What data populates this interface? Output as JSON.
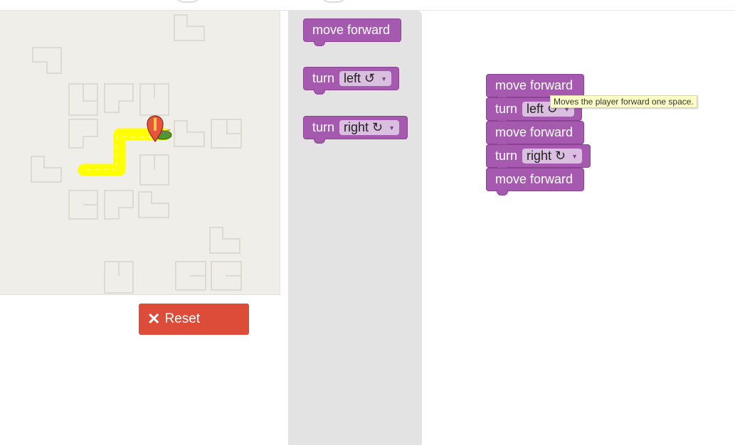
{
  "reset": {
    "label": "Reset",
    "icon": "close-icon"
  },
  "toolbox": {
    "blocks": [
      {
        "prefix": "move forward"
      },
      {
        "prefix": "turn",
        "option": "left ↺"
      },
      {
        "prefix": "turn",
        "option": "right ↻"
      }
    ]
  },
  "workspace": {
    "blocks": [
      {
        "prefix": "move forward"
      },
      {
        "prefix": "turn",
        "option": "left ↺"
      },
      {
        "prefix": "move forward"
      },
      {
        "prefix": "turn",
        "option": "right ↻"
      },
      {
        "prefix": "move forward"
      }
    ]
  },
  "tooltip": "Moves the player forward one space.",
  "colors": {
    "block": "#a55ab0",
    "reset": "#dd4b39",
    "path": "#ffff00",
    "goal": "#e9553c",
    "player": "#4e9a2a"
  }
}
